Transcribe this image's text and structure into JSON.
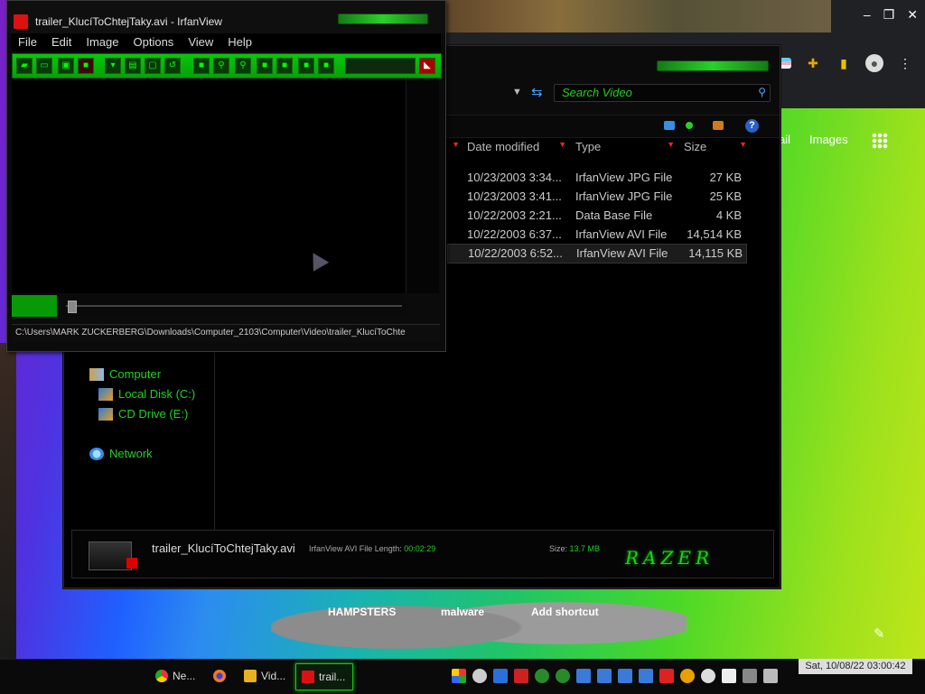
{
  "irfanview": {
    "title": "trailer_KlucíToChtejTaky.avi - IrfanView",
    "menu": [
      "File",
      "Edit",
      "Image",
      "Options",
      "View",
      "Help"
    ],
    "status_path": "C:\\Users\\MARK ZUCKERBERG\\Downloads\\Computer_2103\\Computer\\Video\\trailer_KlucíToChte"
  },
  "explorer": {
    "search_placeholder": "Search Video",
    "columns": {
      "date": "Date modified",
      "type": "Type",
      "size": "Size"
    },
    "files": [
      {
        "date": "10/23/2003 3:34...",
        "type": "IrfanView JPG File",
        "size": "27 KB"
      },
      {
        "date": "10/23/2003 3:41...",
        "type": "IrfanView JPG File",
        "size": "25 KB"
      },
      {
        "date": "10/22/2003 2:21...",
        "type": "Data Base File",
        "size": "4 KB"
      },
      {
        "date": "10/22/2003 6:37...",
        "type": "IrfanView AVI File",
        "size": "14,514 KB"
      },
      {
        "date": "10/22/2003 6:52...",
        "type": "IrfanView AVI File",
        "size": "14,115 KB"
      }
    ],
    "nav": {
      "computer": "Computer",
      "local_disk": "Local Disk (C:)",
      "cd_drive": "CD Drive (E:)",
      "network": "Network"
    },
    "details": {
      "name": "trailer_KlucíToChtejTaky.avi",
      "type_label": "IrfanView AVI File Length:",
      "length": "00:02:29",
      "size_label": "Size:",
      "size": "13.7 MB",
      "logo": "RAZER"
    }
  },
  "browser": {
    "gmail": "ail",
    "images": "Images",
    "shortcuts": [
      "HAMPSTERS",
      "malware",
      "Add shortcut"
    ]
  },
  "taskbar": {
    "buttons": [
      "Ne...",
      "",
      "Vid...",
      "trail..."
    ],
    "clock": "Sat, 10/08/22 03:00:42"
  },
  "colors": {
    "accent": "#1fd11f",
    "window_bg": "#000000"
  }
}
